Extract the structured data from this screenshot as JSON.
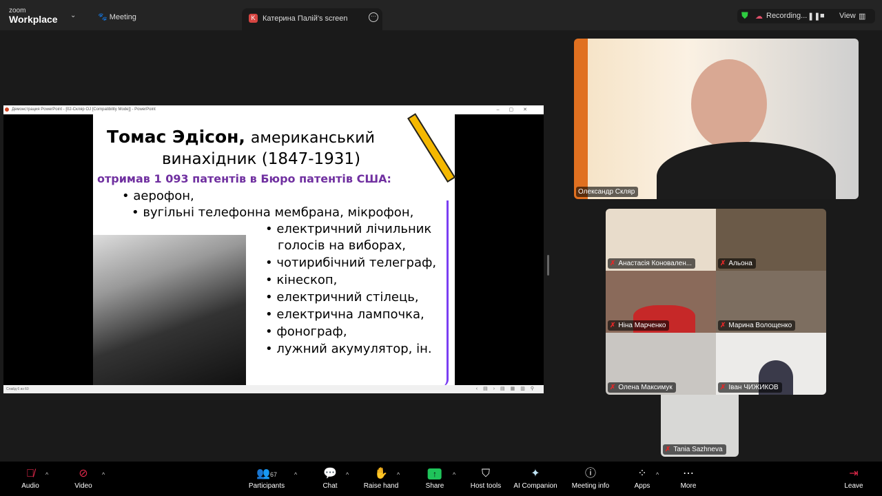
{
  "app": {
    "brand_small": "zoom",
    "brand": "Workplace",
    "meeting_label": "Meeting",
    "share_tab": "Катерина Палій's screen",
    "share_initial": "K",
    "recording": "Recording...",
    "view": "View"
  },
  "ppt": {
    "title": "Демонстрация PowerPoint - [02-Скляр OJ [Compatibility Mode]] - PowerPoint",
    "status": "Слайд 6 из 60",
    "slide": {
      "title_bold": "Томас Эдісон,",
      "title_rest": "американський",
      "title_line2": "винахідник (1847-1931)",
      "subtitle": "отримав 1 093 патентів в Бюро патентів США:",
      "items": [
        "• аерофон,",
        "• вугільні телефонна мембрана, мікрофон,",
        "• електричний лічильник",
        "голосів на виборах,",
        "• чотирибічний телеграф,",
        "• кінескоп,",
        "• електричний стілець,",
        "• електрична лампочка,",
        "• фонограф,",
        "• лужний акумулятор, ін."
      ]
    }
  },
  "participants": {
    "speaker": "Олександр Скляр",
    "tiles": [
      "Анастасія Коновален...",
      "Альона",
      "Ніна Марченко",
      "Марина Волощенко",
      "Олена Максимук",
      "Іван ЧИЖИКОВ",
      "Tania Sazhneva"
    ]
  },
  "toolbar": {
    "audio": "Audio",
    "video": "Video",
    "participants": "Participants",
    "participants_count": "67",
    "chat": "Chat",
    "raise_hand": "Raise hand",
    "share": "Share",
    "host_tools": "Host tools",
    "ai": "AI Companion",
    "info": "Meeting info",
    "apps": "Apps",
    "more": "More",
    "leave": "Leave"
  }
}
